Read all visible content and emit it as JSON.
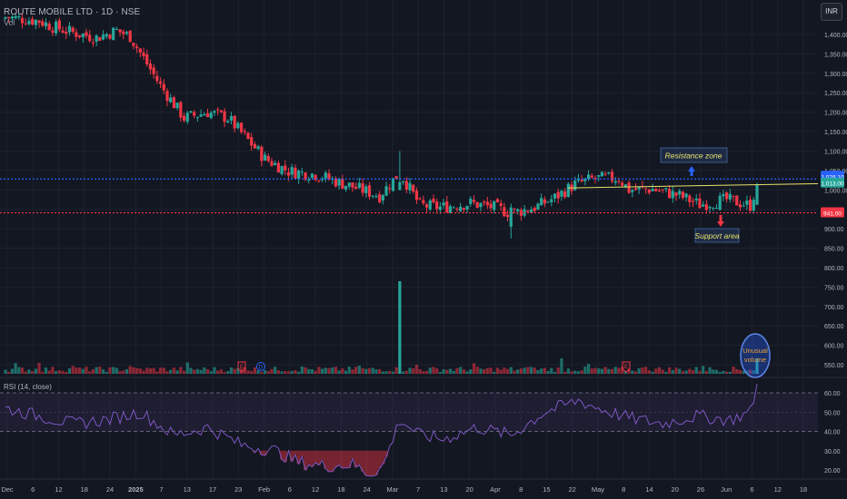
{
  "header": {
    "symbol_line": "ROUTE MOBILE LTD · 1D · NSE",
    "sub_line": "Vol"
  },
  "currency_button": "INR",
  "colors": {
    "background": "#131722",
    "bull": "#26a69a",
    "bear": "#f23645",
    "resistance_line": "#2962ff",
    "support_line": "#f23645",
    "trendline": "#e8e26a",
    "rsi_line": "#7e57c2",
    "annotation_text": "#e8e26a"
  },
  "chart_data": [
    {
      "type": "candlestick",
      "title": "ROUTE MOBILE LTD · 1D · NSE",
      "price_axis_ticks": [
        "1,400.00",
        "1,350.00",
        "1,300.00",
        "1,250.00",
        "1,200.00",
        "1,150.00",
        "1,100.00",
        "1,050.00",
        "1,000.00",
        "950.00",
        "900.00",
        "850.00",
        "800.00",
        "750.00",
        "700.00",
        "650.00",
        "600.00",
        "550.00"
      ],
      "ylim": [
        530,
        1460
      ],
      "time_axis_ticks": [
        "Dec",
        "6",
        "12",
        "18",
        "24",
        "2025",
        "7",
        "13",
        "17",
        "23",
        "Feb",
        "6",
        "12",
        "18",
        "24",
        "Mar",
        "7",
        "13",
        "20",
        "Apr",
        "8",
        "15",
        "22",
        "May",
        "8",
        "14",
        "20",
        "26",
        "Jun",
        "6",
        "12",
        "18"
      ],
      "price_labels": [
        {
          "text": "1,028.10",
          "value": 1028.1,
          "color": "#2962ff"
        },
        {
          "text": "1,013.00",
          "value": 1013.0,
          "color": "#26a69a"
        },
        {
          "text": "941.00",
          "value": 941.0,
          "color": "#f23645"
        }
      ],
      "resistance_level": 1028.1,
      "support_level": 941.0,
      "trendline": [
        [
          0.694,
          1005
        ],
        [
          1.0,
          1016
        ]
      ],
      "annotations": [
        {
          "text": "Resistance zone",
          "arrow": "up",
          "anchor_value": 1028.1
        },
        {
          "text": "Support area",
          "arrow": "down",
          "anchor_value": 941.0
        },
        {
          "text": "Unusual volume",
          "shape": "circle-highlight"
        }
      ],
      "events": [
        "E",
        "D",
        "E"
      ],
      "volume": {
        "spike_index": 117,
        "last_index": 223
      }
    },
    {
      "type": "line",
      "title": "RSI (14, close)",
      "ticks": [
        "60.00",
        "50.00",
        "40.00",
        "30.00",
        "20.00"
      ],
      "ylim": [
        15,
        68
      ],
      "band": [
        40,
        60
      ]
    }
  ],
  "rsi_title": "RSI (14, close)"
}
